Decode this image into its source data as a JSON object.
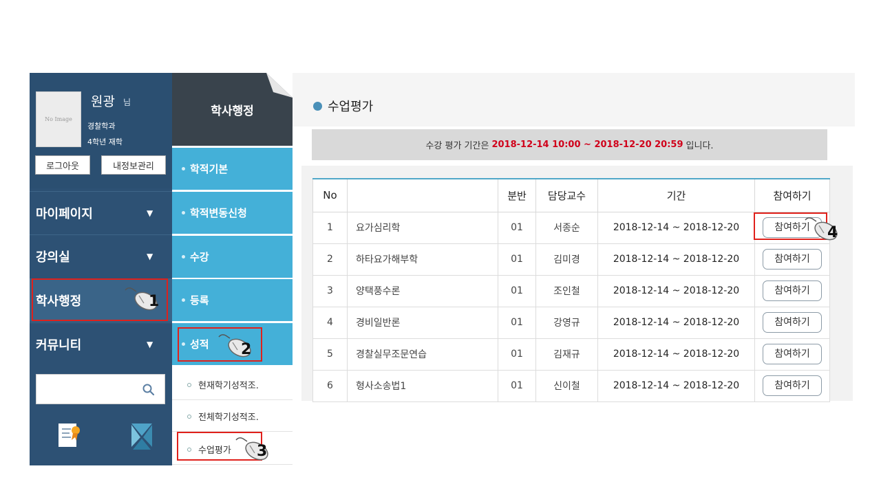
{
  "profile": {
    "avatar_text": "No Image",
    "name": "원광",
    "name_suffix": "님",
    "department": "경찰학과",
    "status": "4학년 재학",
    "logout_label": "로그아웃",
    "profile_label": "내정보관리"
  },
  "sidebar": {
    "items": [
      {
        "label": "마이페이지"
      },
      {
        "label": "강의실"
      },
      {
        "label": "학사행정"
      },
      {
        "label": "커뮤니티"
      }
    ],
    "arrow": "▼"
  },
  "submenu": {
    "header": "학사행정",
    "items": [
      {
        "label": "학적기본"
      },
      {
        "label": "학적변동신청"
      },
      {
        "label": "수강"
      },
      {
        "label": "등록"
      },
      {
        "label": "성적"
      }
    ],
    "subitems": [
      {
        "label": "현재학기성적조."
      },
      {
        "label": "전체학기성적조."
      },
      {
        "label": "수업평가"
      }
    ]
  },
  "main": {
    "title": "수업평가",
    "notice_prefix": "수강 평가 기간은",
    "notice_period": "2018-12-14 10:00 ~ 2018-12-20 20:59",
    "notice_suffix": "입니다."
  },
  "table": {
    "headers": {
      "no": "No",
      "subject": "",
      "section": "분반",
      "professor": "담당교수",
      "period": "기간",
      "join": "참여하기"
    },
    "rows": [
      {
        "no": "1",
        "subject": "요가심리학",
        "section": "01",
        "professor": "서종순",
        "period": "2018-12-14  ~ 2018-12-20",
        "join": "참여하기"
      },
      {
        "no": "2",
        "subject": "하타요가해부학",
        "section": "01",
        "professor": "김미경",
        "period": "2018-12-14  ~ 2018-12-20",
        "join": "참여하기"
      },
      {
        "no": "3",
        "subject": "양택풍수론",
        "section": "01",
        "professor": "조인철",
        "period": "2018-12-14  ~ 2018-12-20",
        "join": "참여하기"
      },
      {
        "no": "4",
        "subject": "경비일반론",
        "section": "01",
        "professor": "강영규",
        "period": "2018-12-14  ~ 2018-12-20",
        "join": "참여하기"
      },
      {
        "no": "5",
        "subject": "경찰실무조문연습",
        "section": "01",
        "professor": "김재규",
        "period": "2018-12-14  ~ 2018-12-20",
        "join": "참여하기"
      },
      {
        "no": "6",
        "subject": "형사소송법1",
        "section": "01",
        "professor": "신이철",
        "period": "2018-12-14  ~ 2018-12-20",
        "join": "참여하기"
      }
    ]
  },
  "steps": [
    "1",
    "2",
    "3",
    "4"
  ],
  "colors": {
    "accent_red": "#e0201b",
    "sidebar": "#2d5174",
    "submenu": "#44b0d8",
    "notice_period": "#d0021b"
  }
}
